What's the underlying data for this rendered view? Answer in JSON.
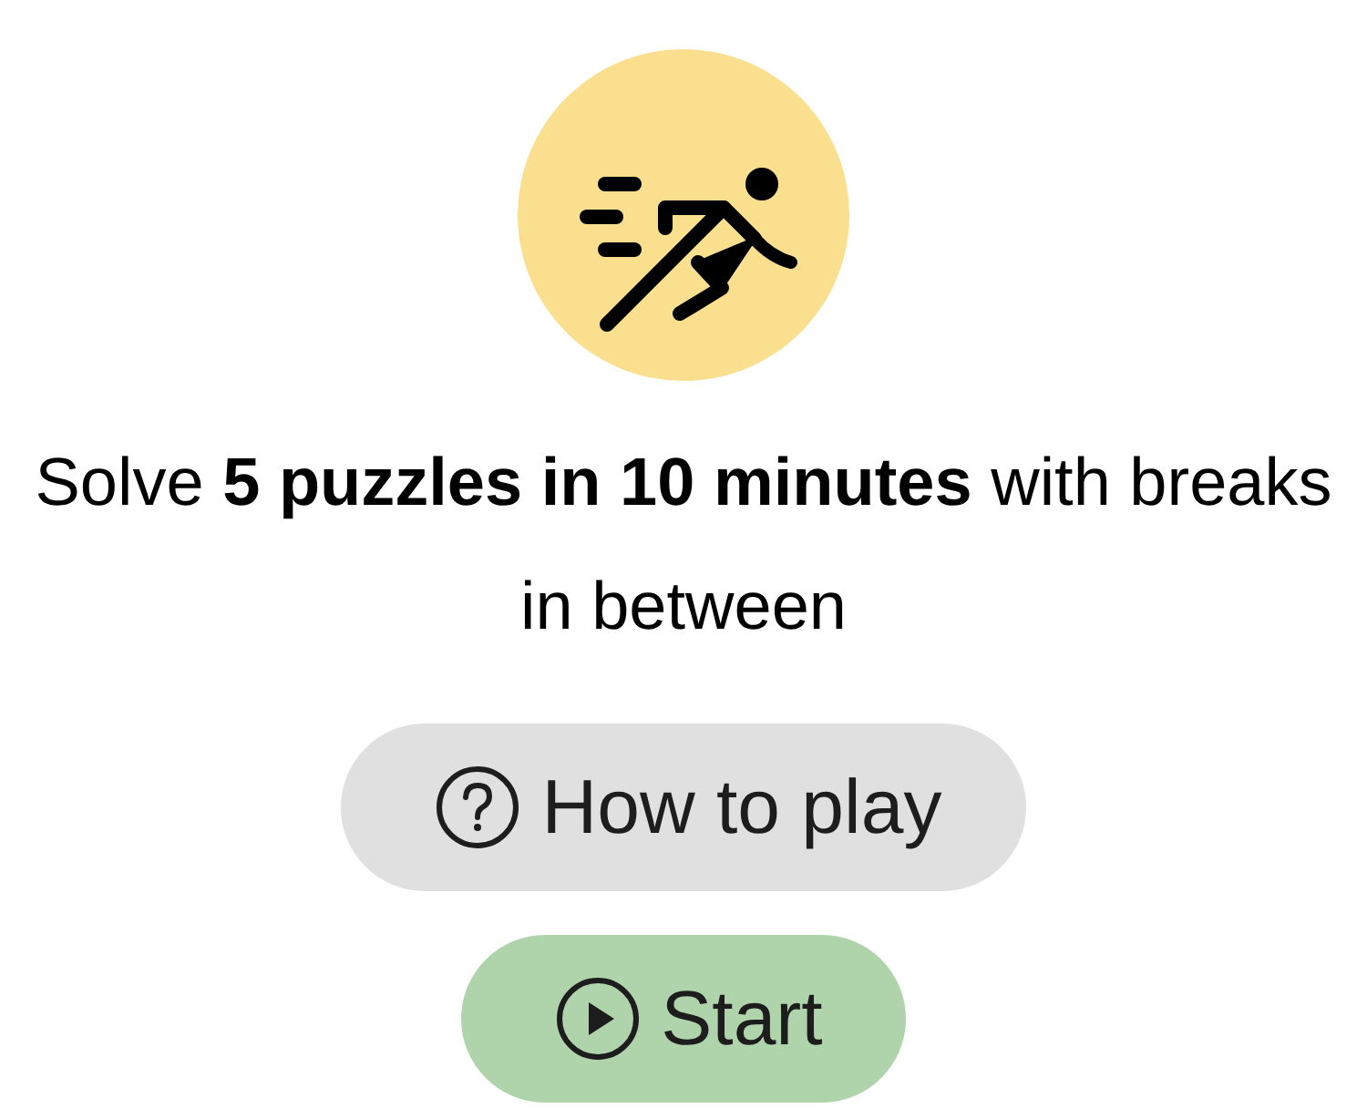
{
  "description": "Solve **5 puzzles in 10 minutes** with breaks in between",
  "buttons": [
    {
      "kind": "help",
      "label": "How to play"
    },
    {
      "kind": "start",
      "label": "Start"
    }
  ]
}
